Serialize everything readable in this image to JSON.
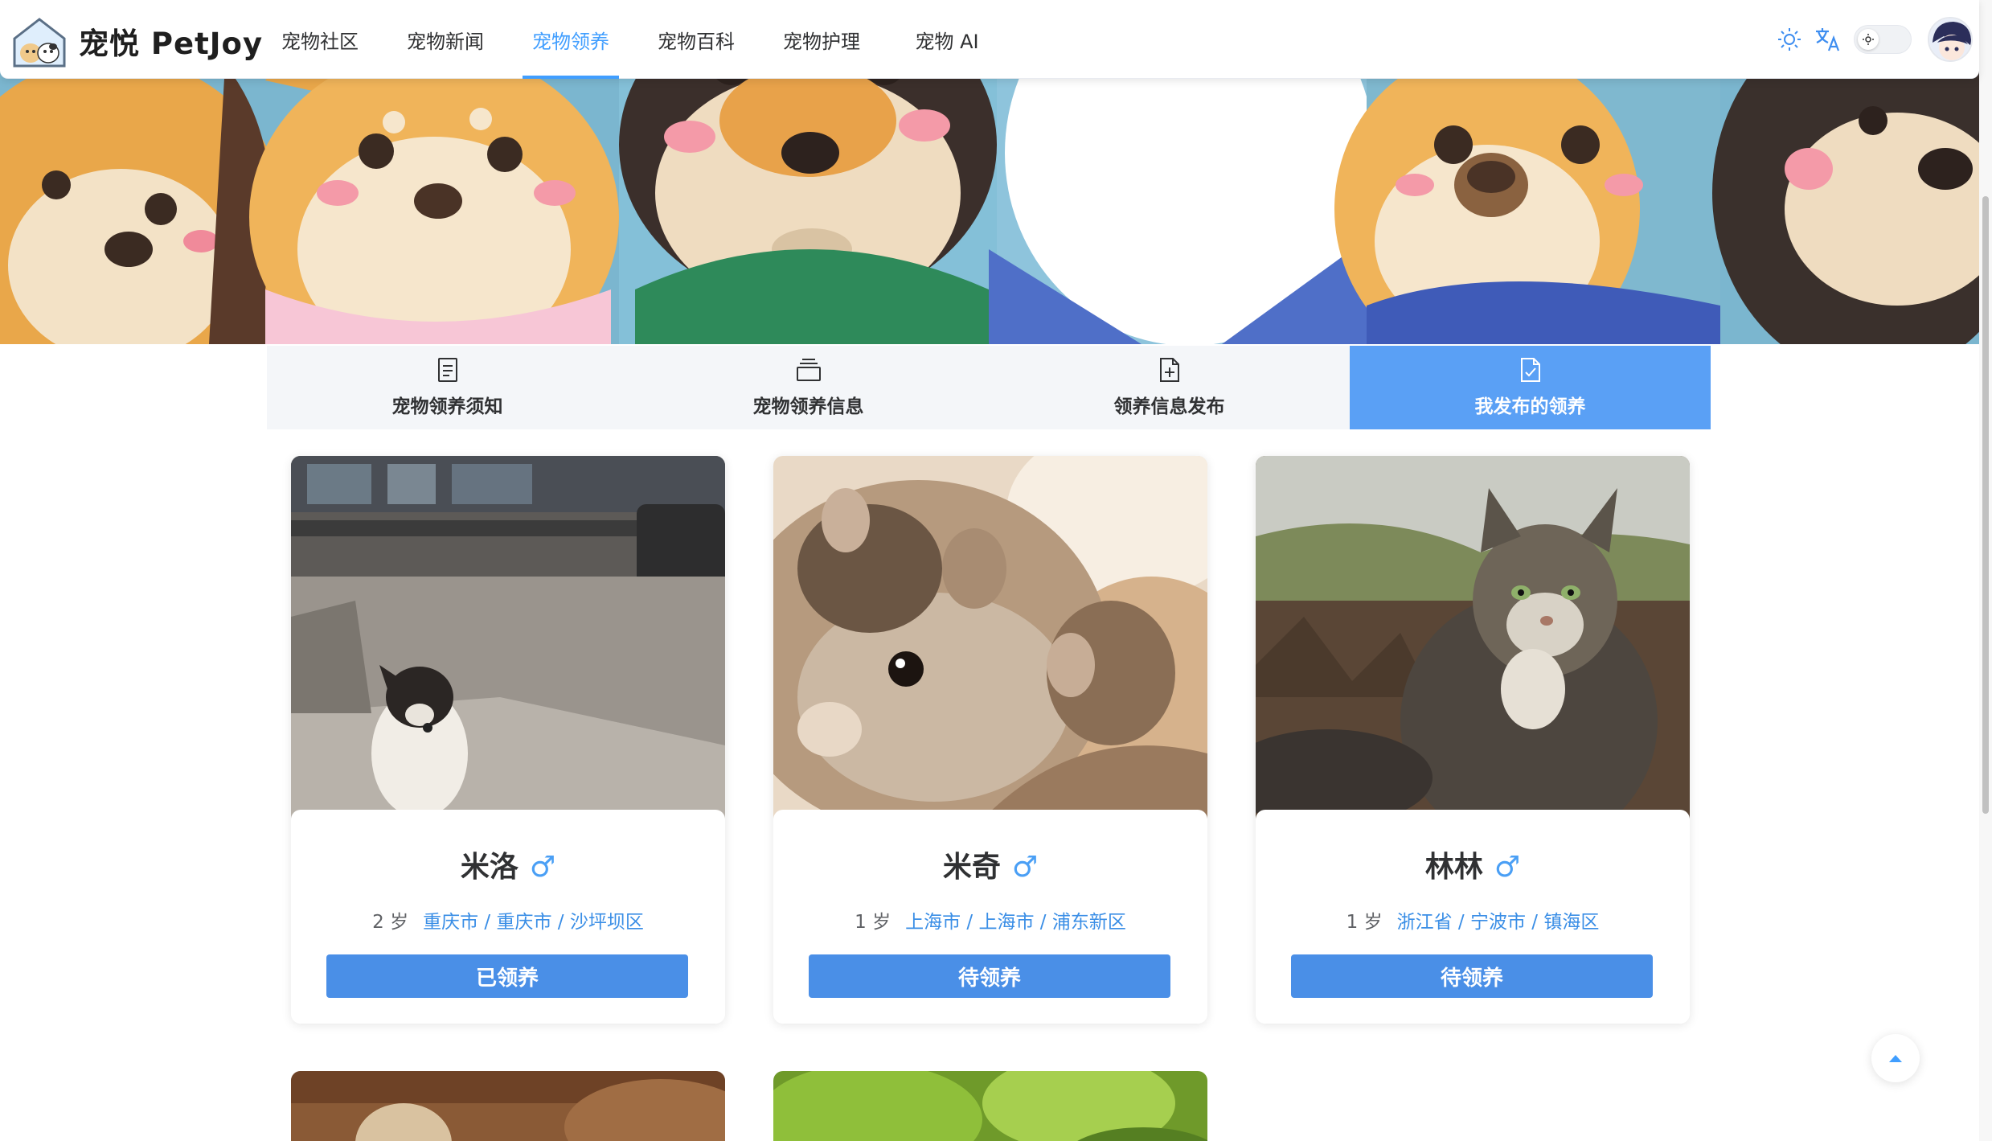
{
  "header": {
    "brand": "宠悦 PetJoy",
    "nav": [
      {
        "label": "宠物社区",
        "active": false
      },
      {
        "label": "宠物新闻",
        "active": false
      },
      {
        "label": "宠物领养",
        "active": true
      },
      {
        "label": "宠物百科",
        "active": false
      },
      {
        "label": "宠物护理",
        "active": false
      },
      {
        "label": "宠物 AI",
        "active": false
      }
    ],
    "tools": [
      "sun-icon",
      "translate-icon",
      "theme-toggle",
      "avatar"
    ]
  },
  "tabs": [
    {
      "label": "宠物领养须知",
      "icon": "document-icon",
      "active": false
    },
    {
      "label": "宠物领养信息",
      "icon": "stack-icon",
      "active": false
    },
    {
      "label": "领养信息发布",
      "icon": "file-add-icon",
      "active": false
    },
    {
      "label": "我发布的领养",
      "icon": "file-check-icon",
      "active": true
    }
  ],
  "pets": [
    {
      "name": "米洛",
      "gender": "♂",
      "age": "2 岁",
      "location": "重庆市 / 重庆市 / 沙坪坝区",
      "status": "已领养",
      "photo": "dog"
    },
    {
      "name": "米奇",
      "gender": "♂",
      "age": "1 岁",
      "location": "上海市 / 上海市 / 浦东新区",
      "status": "待领养",
      "photo": "hamster"
    },
    {
      "name": "林林",
      "gender": "♂",
      "age": "1 岁",
      "location": "浙江省 / 宁波市 / 镇海区",
      "status": "待领养",
      "photo": "cat"
    }
  ],
  "colors": {
    "accent": "#409eff",
    "active_tab": "#5aa0f5",
    "status_button": "#4a8fe7",
    "location_text": "#3a8ee6"
  }
}
